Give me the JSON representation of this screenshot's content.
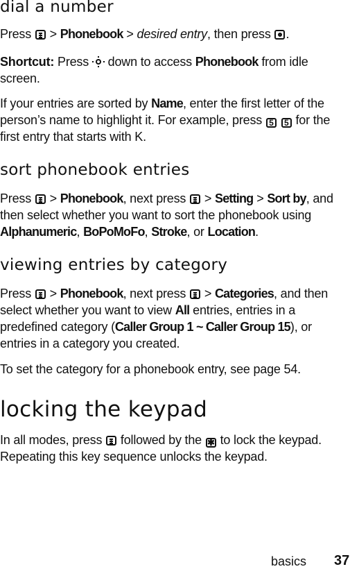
{
  "sections": {
    "dial": {
      "title": "dial a number",
      "p1": {
        "press": "Press",
        "gt1": ">",
        "phonebook": "Phonebook",
        "gt2": ">",
        "desired": "desired entry",
        "then": ", then press",
        "end": "."
      },
      "p2": {
        "shortcut": "Shortcut:",
        "press": "Press",
        "down": "down to access",
        "phonebook": "Phonebook",
        "rest": "from idle screen."
      },
      "p3": {
        "a": "If your entries are sorted by",
        "name": "Name",
        "b": ", enter the first letter of the person’s name to highlight it. For example, press",
        "key1": "5",
        "key2": "5",
        "c": "for the first entry that starts with K."
      }
    },
    "sort": {
      "title": "sort phonebook entries",
      "p1": {
        "press": "Press",
        "gt1": ">",
        "phonebook": "Phonebook",
        "next": ", next press",
        "gt2": ">",
        "setting": "Setting",
        "gt3": ">",
        "sortby": "Sort by",
        "rest": ", and then select whether you want to sort the phonebook using",
        "opt1": "Alphanumeric",
        "c1": ",",
        "opt2": "BoPoMoFo",
        "c2": ",",
        "opt3": "Stroke",
        "or": ", or",
        "opt4": "Location",
        "end": "."
      }
    },
    "category": {
      "title": "viewing entries by category",
      "p1": {
        "press": "Press",
        "gt1": ">",
        "phonebook": "Phonebook",
        "next": ", next press",
        "gt2": ">",
        "categories": "Categories",
        "rest": ", and then select whether you want to view",
        "all": "All",
        "mid": "entries, entries in a predefined category (",
        "group": "Caller Group 1 ~ Caller Group 15",
        "end": "), or entries in a category you created."
      },
      "p2": "To set the category for a phonebook entry, see page 54."
    },
    "lock": {
      "title": "locking the keypad",
      "p1": {
        "a": "In all modes, press",
        "b": "followed by the",
        "star": "✱",
        "c": "to lock the keypad. Repeating this key sequence unlocks the keypad."
      }
    }
  },
  "icons": {
    "menu_key": "menu-key-icon",
    "center_key": "center-select-key-icon",
    "nav_key": "navigation-key-icon",
    "star_key": "star-key-icon"
  },
  "footer": {
    "section": "basics",
    "page": "37"
  }
}
